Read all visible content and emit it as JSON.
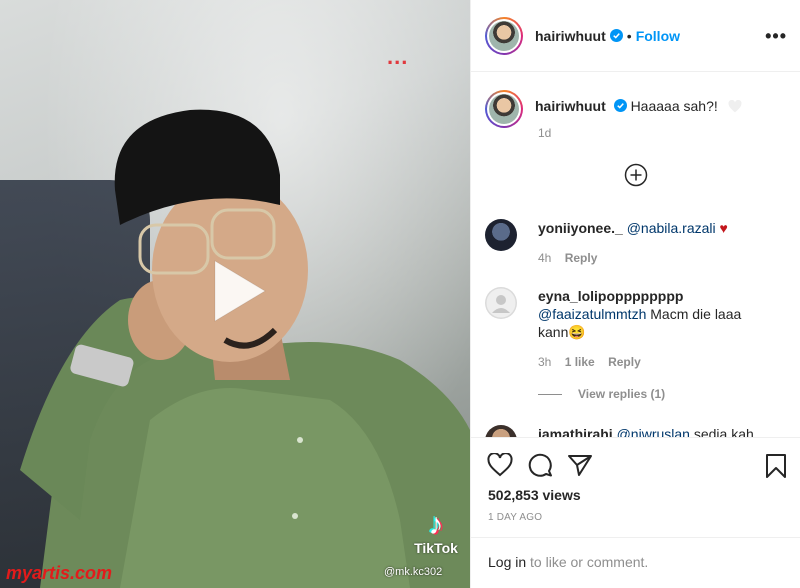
{
  "media": {
    "more_dots": "...",
    "tiktok_word": "TikTok",
    "tiktok_handle": "@mk.kc302",
    "watermark": "myartis.com"
  },
  "header": {
    "username": "hairiwhuut",
    "separator": "•",
    "follow_label": "Follow"
  },
  "caption": {
    "username": "hairiwhuut",
    "text": "Haaaaa sah?!",
    "time": "1d"
  },
  "comments": [
    {
      "username": "yoniiyonee._",
      "mention": "@nabila.razali",
      "text": "",
      "time": "4h",
      "likes": "",
      "reply_label": "Reply"
    },
    {
      "username": "eyna_lolipopppppppp",
      "mention": "@faaizatulmmtzh",
      "text": "Macm die laaa kann😆",
      "time": "3h",
      "likes": "1 like",
      "reply_label": "Reply"
    },
    {
      "username": "jamathirahi",
      "mention": "@niwruslan",
      "text": "sedia kah",
      "time": "",
      "likes": "",
      "reply_label": ""
    }
  ],
  "view_replies": "View replies (1)",
  "stats": {
    "views": "502,853 views",
    "date": "1 DAY AGO"
  },
  "login": {
    "link": "Log in",
    "rest": "to like or comment."
  },
  "colors": {
    "accent": "#0095f6",
    "heart": "#c3161c"
  }
}
